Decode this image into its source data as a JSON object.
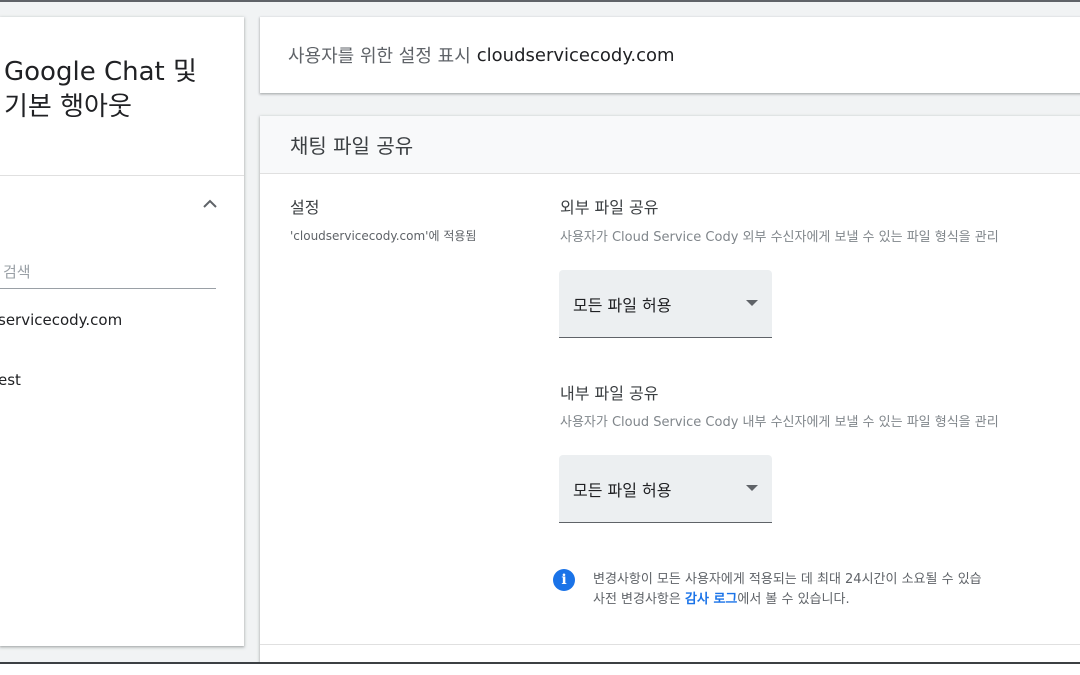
{
  "sidebar": {
    "title_line1": "Google Chat 및",
    "title_line2": "기본 행아웃",
    "search_placeholder": "검색",
    "org_units": [
      "servicecody.com",
      "est"
    ]
  },
  "header": {
    "prefix": "사용자를 위한 설정 표시",
    "domain": "cloudservicecody.com"
  },
  "card": {
    "title": "채팅 파일 공유",
    "setting_label": "설정",
    "applied_to": "'cloudservicecody.com'에 적용됨",
    "external": {
      "title": "외부 파일 공유",
      "description": "사용자가 Cloud Service Cody 외부 수신자에게 보낼 수 있는 파일 형식을 관리",
      "value": "모든 파일 허용"
    },
    "internal": {
      "title": "내부 파일 공유",
      "description": "사용자가 Cloud Service Cody 내부 수신자에게 보낼 수 있는 파일 형식을 관리",
      "value": "모든 파일 허용"
    },
    "info": {
      "line1": "변경사항이 모든 사용자에게 적용되는 데 최대 24시간이 소요될 수 있습",
      "line2_prefix": "사전 변경사항은",
      "link": "감사 로그",
      "line2_suffix": "에서 볼 수 있습니다."
    }
  },
  "colors": {
    "accent": "#1a73e8",
    "dropdown_bg": "#eceff1",
    "page_bg": "#f1f3f4"
  }
}
